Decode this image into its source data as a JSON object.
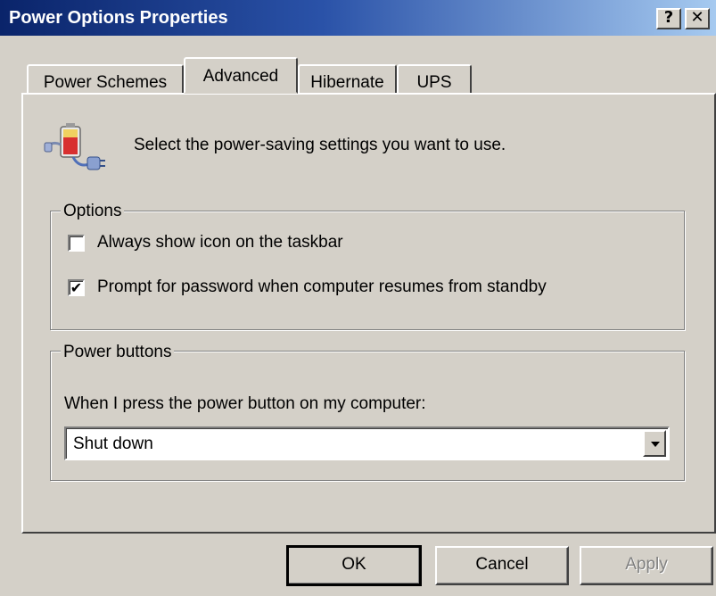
{
  "window": {
    "title": "Power Options Properties",
    "help_label": "?",
    "close_label": "✕"
  },
  "tabs": [
    {
      "label": "Power Schemes"
    },
    {
      "label": "Advanced"
    },
    {
      "label": "Hibernate"
    },
    {
      "label": "UPS"
    }
  ],
  "active_tab": "Advanced",
  "advanced": {
    "icon": "power-plug-battery-icon",
    "intro": "Select the power-saving settings you want to use.",
    "options": {
      "legend": "Options",
      "always_show_icon": {
        "label": "Always show icon on the taskbar",
        "checked": false
      },
      "prompt_password": {
        "label": "Prompt for password when computer resumes from standby",
        "checked": true,
        "mark": "✔"
      }
    },
    "power_buttons": {
      "legend": "Power buttons",
      "prompt": "When I press the power button on my computer:",
      "selected": "Shut down"
    }
  },
  "buttons": {
    "ok": "OK",
    "cancel": "Cancel",
    "apply": "Apply",
    "apply_enabled": false
  },
  "colors": {
    "titlebar_start": "#0a246a",
    "titlebar_end": "#a6caf0",
    "face": "#d4d0c8"
  }
}
